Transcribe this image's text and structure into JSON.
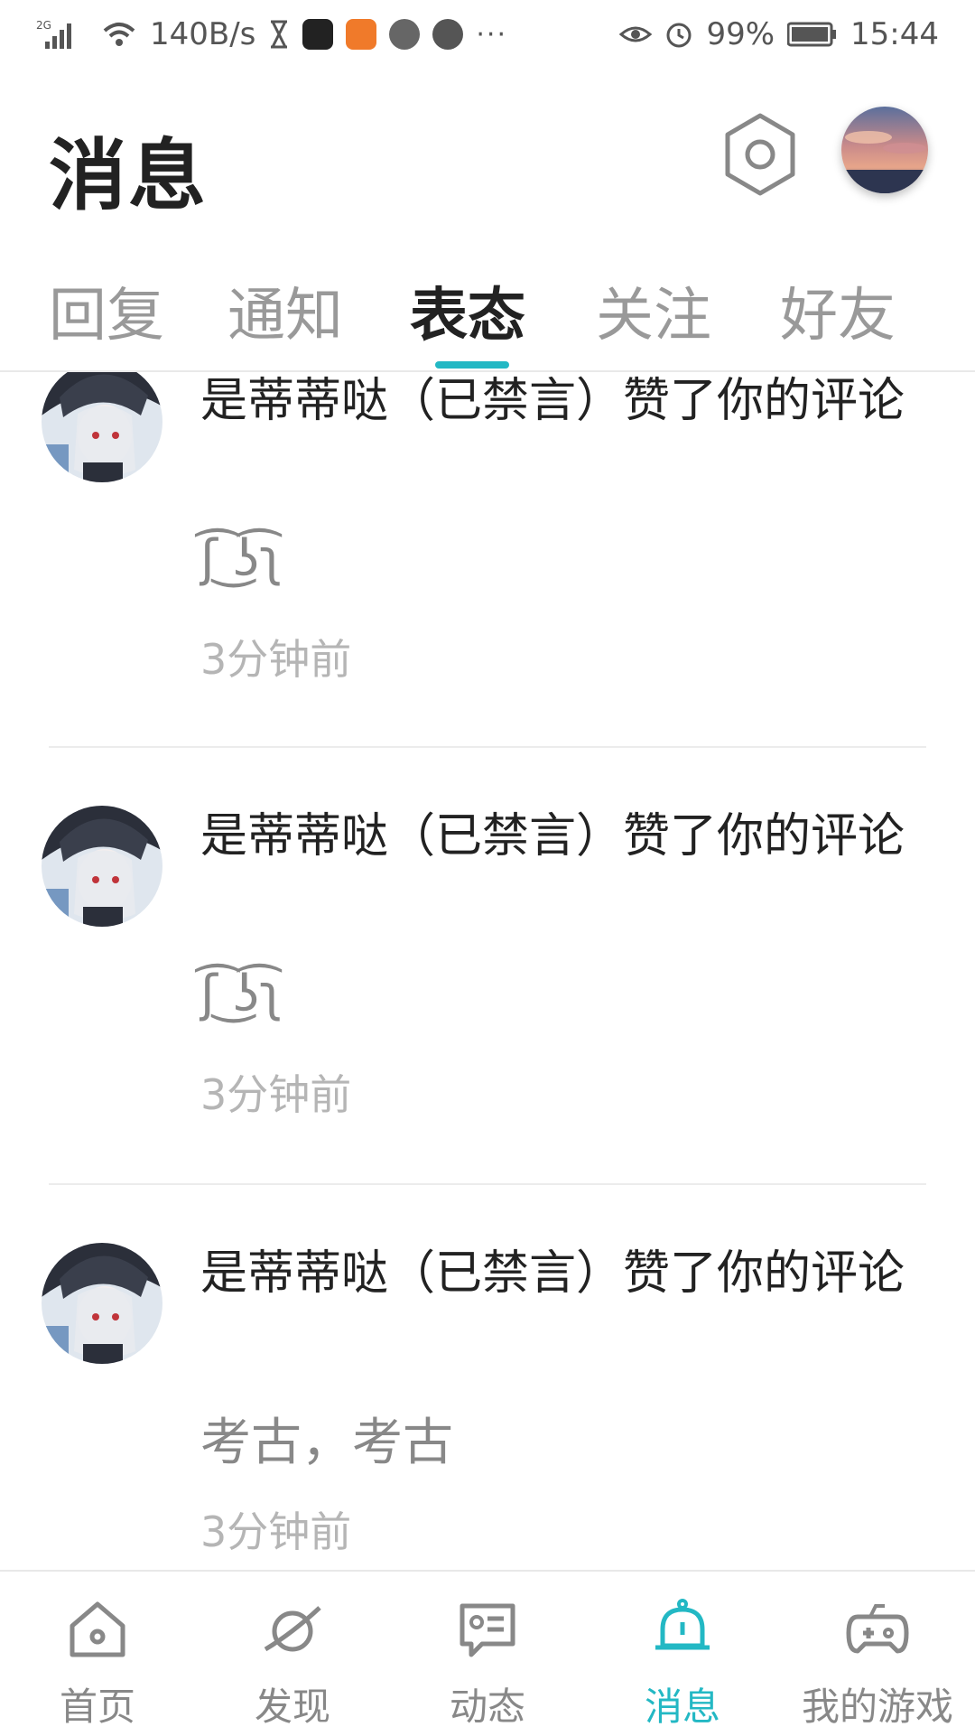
{
  "status_bar": {
    "network": "2G",
    "speed": "140B/s",
    "more": "···",
    "battery": "99%",
    "time": "15:44"
  },
  "header": {
    "title": "消息"
  },
  "tabs": [
    {
      "label": "回复",
      "active": false
    },
    {
      "label": "通知",
      "active": false
    },
    {
      "label": "表态",
      "active": true
    },
    {
      "label": "关注",
      "active": false
    },
    {
      "label": "好友",
      "active": false
    }
  ],
  "feed": [
    {
      "title": "是蒂蒂哒（已禁言）赞了你的评论",
      "content": "ʃ͡ ͜ʖ͡ʅ",
      "time": "3分钟前"
    },
    {
      "title": "是蒂蒂哒（已禁言）赞了你的评论",
      "content": "ʃ͡ ͜ʖ͡ʅ",
      "time": "3分钟前"
    },
    {
      "title": "是蒂蒂哒（已禁言）赞了你的评论",
      "content": "考古，考古",
      "time": "3分钟前"
    }
  ],
  "bottom_nav": [
    {
      "label": "首页",
      "icon": "home-icon",
      "active": false
    },
    {
      "label": "发现",
      "icon": "planet-icon",
      "active": false
    },
    {
      "label": "动态",
      "icon": "message-card-icon",
      "active": false
    },
    {
      "label": "消息",
      "icon": "bell-icon",
      "active": true
    },
    {
      "label": "我的游戏",
      "icon": "gamepad-icon",
      "active": false
    }
  ],
  "colors": {
    "accent": "#23b8c4",
    "text_primary": "#222222",
    "text_secondary": "#888888",
    "text_muted": "#b5b5b5"
  }
}
